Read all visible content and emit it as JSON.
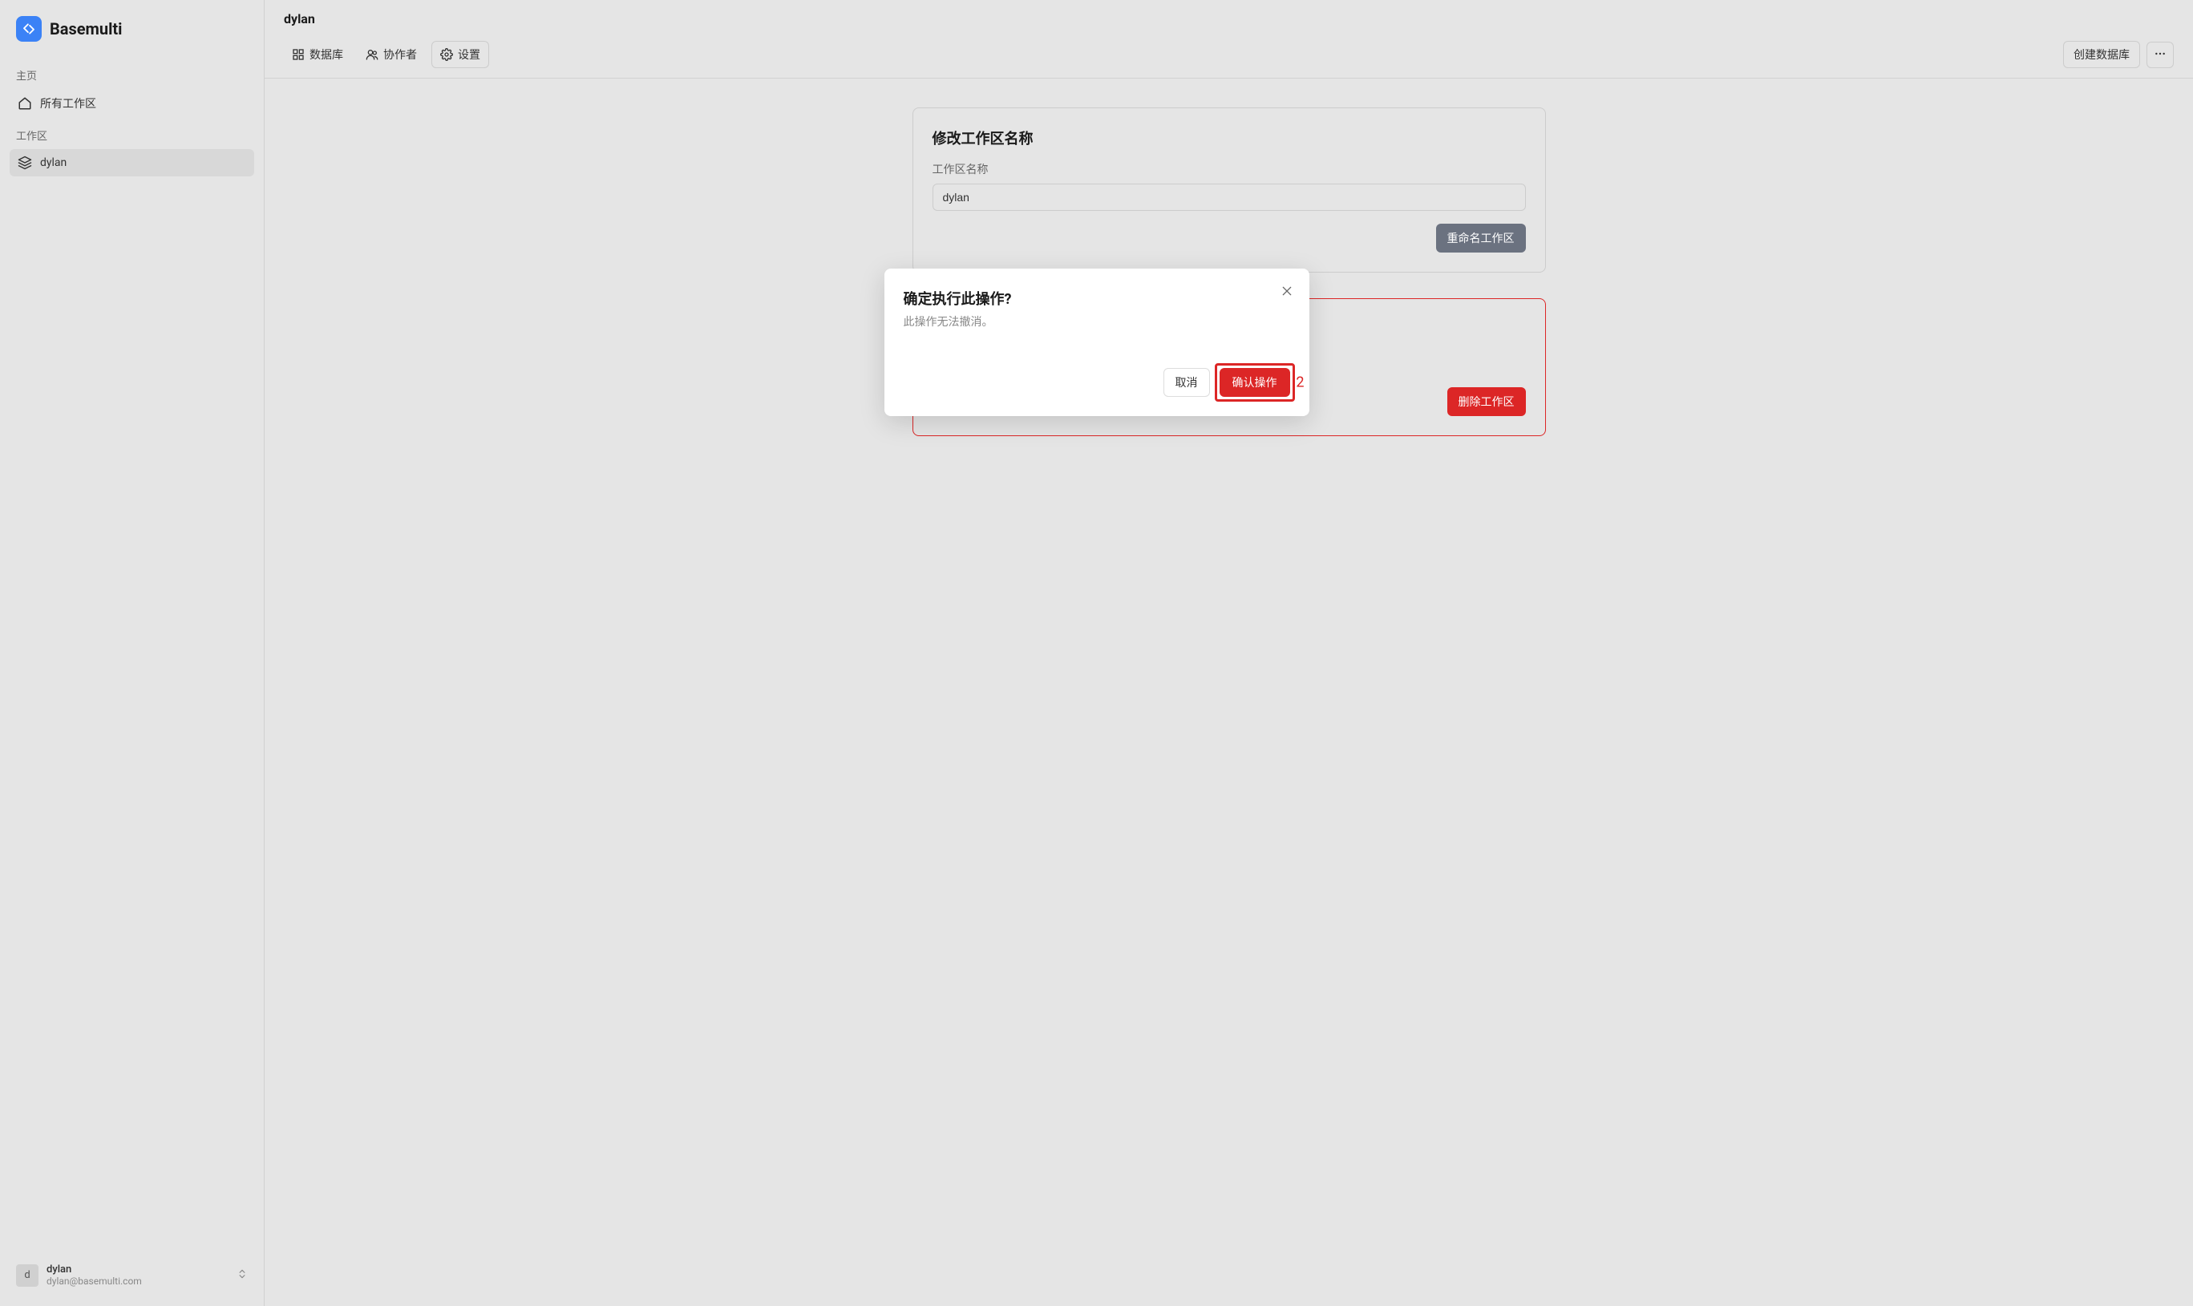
{
  "app": {
    "name": "Basemulti"
  },
  "sidebar": {
    "home_section": "主页",
    "all_workspaces": "所有工作区",
    "workspace_section": "工作区",
    "workspace_items": [
      {
        "label": "dylan"
      }
    ],
    "user": {
      "avatar_initial": "d",
      "name": "dylan",
      "email": "dylan@basemulti.com"
    }
  },
  "header": {
    "title": "dylan",
    "tabs": {
      "databases": "数据库",
      "collaborators": "协作者",
      "settings": "设置"
    },
    "create_db_button": "创建数据库"
  },
  "settings": {
    "rename_card": {
      "title": "修改工作区名称",
      "field_label": "工作区名称",
      "field_value": "dylan",
      "button": "重命名工作区"
    },
    "delete_card": {
      "button": "删除工作区"
    }
  },
  "modal": {
    "title": "确定执行此操作?",
    "description": "此操作无法撤消。",
    "cancel": "取消",
    "confirm": "确认操作",
    "highlight_number": "2"
  }
}
